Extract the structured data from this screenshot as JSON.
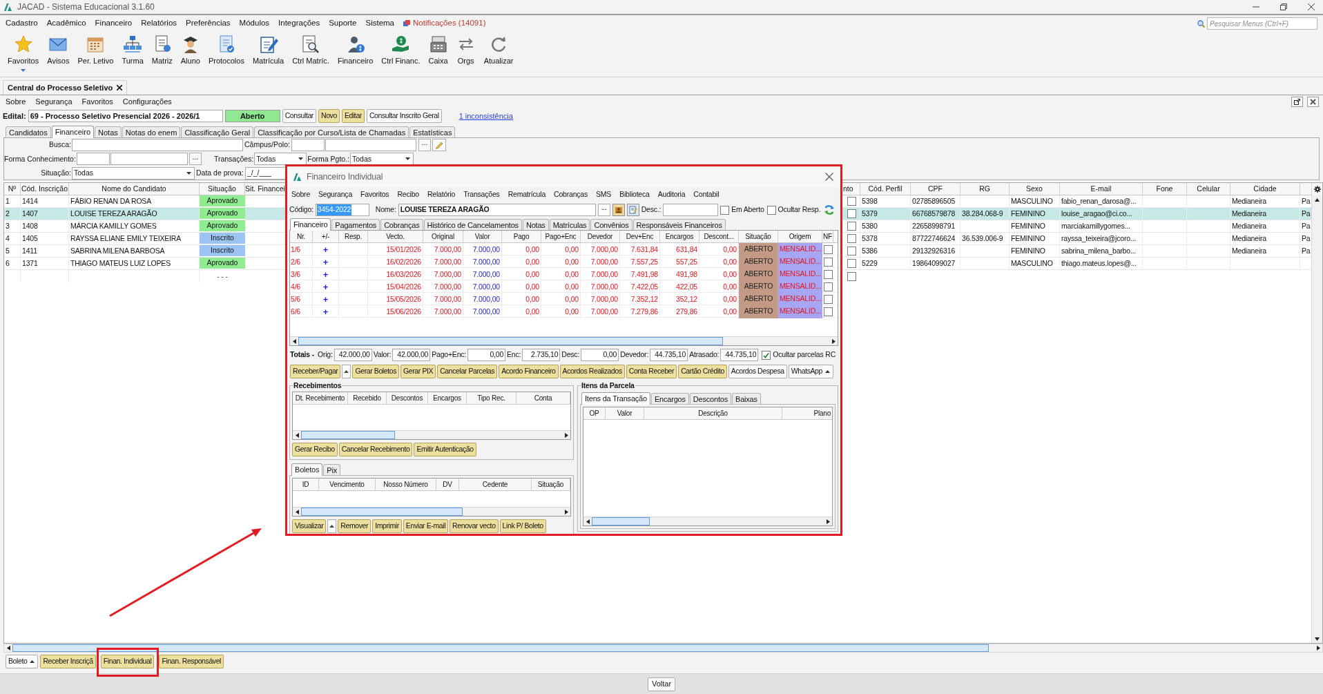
{
  "window": {
    "title": "JACAD - Sistema Educacional 3.1.60"
  },
  "menu": [
    "Cadastro",
    "Acadêmico",
    "Financeiro",
    "Relatórios",
    "Preferências",
    "Módulos",
    "Integrações",
    "Suporte",
    "Sistema"
  ],
  "notifications": "Notificações (14091)",
  "menu_search": {
    "placeholder": "Pesquisar Menus (Ctrl+F)"
  },
  "toolbar": [
    {
      "label": "Favoritos",
      "dropdown": true
    },
    {
      "label": "Avisos"
    },
    {
      "label": "Per. Letivo"
    },
    {
      "label": "Turma"
    },
    {
      "label": "Matriz"
    },
    {
      "label": "Aluno"
    },
    {
      "label": "Protocolos"
    },
    {
      "label": "Matrícula"
    },
    {
      "label": "Ctrl Matríc."
    },
    {
      "label": "Financeiro"
    },
    {
      "label": "Ctrl Financ."
    },
    {
      "label": "Caixa"
    },
    {
      "label": "Orgs"
    },
    {
      "label": "Atualizar"
    }
  ],
  "document_tab": {
    "title": "Central do Processo Seletivo"
  },
  "submenu": [
    "Sobre",
    "Segurança",
    "Favoritos",
    "Configurações"
  ],
  "edital": {
    "label": "Edital:",
    "value": "69 - Processo Seletivo Presencial 2026 - 2026/1",
    "status": "Aberto",
    "buttons": [
      {
        "label": "Consultar",
        "kind": "plain"
      },
      {
        "label": "Novo",
        "kind": "action"
      },
      {
        "label": "Editar",
        "kind": "action"
      },
      {
        "label": "Consultar Inscrito Geral",
        "kind": "plain"
      }
    ],
    "link": "1 inconsistência"
  },
  "tabs": [
    {
      "label": "Candidatos",
      "selected": false
    },
    {
      "label": "Financeiro",
      "selected": true
    },
    {
      "label": "Notas",
      "selected": false
    },
    {
      "label": "Notas do enem",
      "selected": false
    },
    {
      "label": "Classificação Geral",
      "selected": false
    },
    {
      "label": "Classificação por Curso/Lista de Chamadas",
      "selected": false
    },
    {
      "label": "Estatísticas",
      "selected": false
    }
  ],
  "filters": {
    "busca": {
      "label": "Busca:"
    },
    "campus": {
      "label": "Câmpus/Polo:",
      "button": "..."
    },
    "forma_conhecimento": {
      "label": "Forma Conhecimento:",
      "button": "..."
    },
    "transacoes": {
      "label": "Transações:",
      "value": "Todas"
    },
    "forma_pgto": {
      "label": "Forma Pgto.:",
      "value": "Todas"
    },
    "situacao": {
      "label": "Situação:",
      "value": "Todas"
    },
    "data_prova": {
      "label": "Data de prova:",
      "value": "_/_/___"
    }
  },
  "table": {
    "columns": [
      "Nº",
      "Cód. Inscrição",
      "Nome do Candidato",
      "Situação",
      "Sit. Financei",
      "nto",
      "Cód. Perfil",
      "CPF",
      "RG",
      "Sexo",
      "E-mail",
      "Fone",
      "Celular",
      "Cidade"
    ],
    "rows": [
      {
        "no": "1",
        "code": "1414",
        "name": "FÁBIO RENAN DA ROSA",
        "status": "Aprovado",
        "color": "#90ec90",
        "checked": false,
        "profile": "5398",
        "cpf": "02785896505",
        "sex": "MASCULINO",
        "email": "fabio_renan_darosa@...",
        "city": "Medianeira",
        "column_16": "Pa",
        "selected": false
      },
      {
        "no": "2",
        "code": "1407",
        "name": "LOUISE TEREZA ARAGÃO",
        "status": "Aprovado",
        "color": "#90ec90",
        "checked": false,
        "profile": "5379",
        "cpf": "66768579878",
        "rg": "38.284.068-9",
        "sex": "FEMININO",
        "email": "louise_aragao@ci.co...",
        "city": "Medianeira",
        "column_16": "Pa",
        "selected": true
      },
      {
        "no": "3",
        "code": "1408",
        "name": "MÁRCIA KAMILLY GOMES",
        "status": "Aprovado",
        "color": "#90ec90",
        "checked": false,
        "profile": "5380",
        "cpf": "22658998791",
        "sex": "FEMININO",
        "email": "marciakamillygomes...",
        "city": "Medianeira",
        "column_16": "Pa",
        "selected": false
      },
      {
        "no": "4",
        "code": "1405",
        "name": "RAYSSA ELIANE EMILY TEIXEIRA",
        "status": "Inscrito",
        "color": "#9cc4f2",
        "checked": false,
        "profile": "5378",
        "cpf": "87722746624",
        "rg": "36.539.006-9",
        "sex": "FEMININO",
        "email": "rayssa_teixeira@jcoro...",
        "city": "Medianeira",
        "column_16": "Pa",
        "selected": false
      },
      {
        "no": "5",
        "code": "1411",
        "name": "SABRINA MILENA BARBOSA",
        "status": "Inscrito",
        "color": "#9cc4f2",
        "checked": false,
        "profile": "5386",
        "cpf": "29132926316",
        "sex": "FEMININO",
        "email": "sabrina_milena_barbo...",
        "city": "Medianeira",
        "column_16": "Pa",
        "selected": false
      },
      {
        "no": "6",
        "code": "1371",
        "name": "THIAGO MATEUS LUIZ LOPES",
        "status": "Aprovado",
        "color": "#90ec90",
        "checked": false,
        "profile": "5229",
        "cpf": "19864099027",
        "sex": "MASCULINO",
        "email": "thiago.mateus.lopes@...",
        "selected": false
      }
    ],
    "new_row": {
      "status": "- - -",
      "checked": false
    }
  },
  "bottom_buttons": [
    {
      "label": "Boleto",
      "kind": "plain",
      "caret": true
    },
    {
      "label": "Receber Inscriçã",
      "kind": "action"
    },
    {
      "label": "Finan. Individual",
      "kind": "action"
    },
    {
      "label": "Finan. Responsável",
      "kind": "action"
    }
  ],
  "footer_button": "Voltar",
  "dialog": {
    "title": "Financeiro Individual",
    "menu": [
      "Sobre",
      "Segurança",
      "Favoritos",
      "Recibo",
      "Relatório",
      "Transações",
      "Rematrícula",
      "Cobranças",
      "SMS",
      "Biblioteca",
      "Auditoria",
      "Contabil"
    ],
    "codigo": {
      "label": "Código:",
      "value": "3454-2022"
    },
    "nome": {
      "label": "Nome:",
      "value": "LOUISE TEREZA ARAGÃO",
      "button": "..."
    },
    "desc": {
      "label": "Desc.:"
    },
    "options": [
      {
        "label": "Em Aberto",
        "checked": false
      },
      {
        "label": "Ocultar Resp.",
        "checked": false
      }
    ],
    "tabs": [
      {
        "label": "Financeiro",
        "selected": true
      },
      {
        "label": "Pagamentos",
        "selected": false
      },
      {
        "label": "Cobranças",
        "selected": false
      },
      {
        "label": "Histórico de Cancelamentos",
        "selected": false
      },
      {
        "label": "Notas",
        "selected": false
      },
      {
        "label": "Matrículas",
        "selected": false
      },
      {
        "label": "Convênios",
        "selected": false
      },
      {
        "label": "Responsáveis Financeiros",
        "selected": false
      }
    ],
    "installments": {
      "columns": [
        "Nr.",
        "+/-",
        "Resp.",
        "Vecto.",
        "Original",
        "Valor",
        "Pago",
        "Pago+Enc",
        "Devedor",
        "Dev+Enc",
        "Encargos",
        "Descont...",
        "Situação",
        "Origem",
        "NF"
      ],
      "rows": [
        {
          "nr": "1/6",
          "sign": "+",
          "vecto": "15/01/2026",
          "original": "7.000,00",
          "valor": "7.000,00",
          "pago": "0,00",
          "pago_enc": "0,00",
          "devedor": "7.000,00",
          "dev_enc": "7.631,84",
          "encargos": "631,84",
          "descontos": "0,00",
          "situacao": "ABERTO",
          "origem": "MENSALID...",
          "nf_checked": false
        },
        {
          "nr": "2/6",
          "sign": "+",
          "vecto": "16/02/2026",
          "original": "7.000,00",
          "valor": "7.000,00",
          "pago": "0,00",
          "pago_enc": "0,00",
          "devedor": "7.000,00",
          "dev_enc": "7.557,25",
          "encargos": "557,25",
          "descontos": "0,00",
          "situacao": "ABERTO",
          "origem": "MENSALID...",
          "nf_checked": false
        },
        {
          "nr": "3/6",
          "sign": "+",
          "vecto": "16/03/2026",
          "original": "7.000,00",
          "valor": "7.000,00",
          "pago": "0,00",
          "pago_enc": "0,00",
          "devedor": "7.000,00",
          "dev_enc": "7.491,98",
          "encargos": "491,98",
          "descontos": "0,00",
          "situacao": "ABERTO",
          "origem": "MENSALID...",
          "nf_checked": false
        },
        {
          "nr": "4/6",
          "sign": "+",
          "vecto": "15/04/2026",
          "original": "7.000,00",
          "valor": "7.000,00",
          "pago": "0,00",
          "pago_enc": "0,00",
          "devedor": "7.000,00",
          "dev_enc": "7.422,05",
          "encargos": "422,05",
          "descontos": "0,00",
          "situacao": "ABERTO",
          "origem": "MENSALID...",
          "nf_checked": false
        },
        {
          "nr": "5/6",
          "sign": "+",
          "vecto": "15/05/2026",
          "original": "7.000,00",
          "valor": "7.000,00",
          "pago": "0,00",
          "pago_enc": "0,00",
          "devedor": "7.000,00",
          "dev_enc": "7.352,12",
          "encargos": "352,12",
          "descontos": "0,00",
          "situacao": "ABERTO",
          "origem": "MENSALID...",
          "nf_checked": false
        },
        {
          "nr": "6/6",
          "sign": "+",
          "vecto": "15/06/2026",
          "original": "7.000,00",
          "valor": "7.000,00",
          "pago": "0,00",
          "pago_enc": "0,00",
          "devedor": "7.000,00",
          "dev_enc": "7.279,86",
          "encargos": "279,86",
          "descontos": "0,00",
          "situacao": "ABERTO",
          "origem": "MENSALID...",
          "nf_checked": false
        }
      ]
    },
    "totals": {
      "label": "Totais -",
      "fields": [
        {
          "label": "Orig:",
          "value": "42.000,00"
        },
        {
          "label": "Valor:",
          "value": "42.000,00"
        },
        {
          "label": "Pago+Enc:",
          "value": "0,00"
        },
        {
          "label": "Enc:",
          "value": "2.735,10"
        },
        {
          "label": "Desc:",
          "value": "0,00"
        },
        {
          "label": "Devedor:",
          "value": "44.735,10"
        },
        {
          "label": "Atrasado:",
          "value": "44.735,10"
        }
      ],
      "hide_rc": {
        "label": "Ocultar parcelas RC",
        "checked": true
      }
    },
    "buttons": [
      {
        "label": "Receber/Pagar",
        "kind": "action",
        "split": true
      },
      {
        "label": "Gerar Boletos",
        "kind": "action"
      },
      {
        "label": "Gerar PIX",
        "kind": "action"
      },
      {
        "label": "Cancelar Parcelas",
        "kind": "action"
      },
      {
        "label": "Acordo Financeiro",
        "kind": "action"
      },
      {
        "label": "Acordos Realizados",
        "kind": "action"
      },
      {
        "label": "Conta Receber",
        "kind": "action"
      },
      {
        "label": "Cartão Crédito",
        "kind": "action"
      },
      {
        "label": "Acordos Despesa",
        "kind": "plain"
      },
      {
        "label": "WhatsApp",
        "kind": "plain",
        "caret": true
      }
    ],
    "receipts": {
      "title": "Recebimentos",
      "columns": [
        "Dt. Recebimento",
        "Recebido",
        "Descontos",
        "Encargos",
        "Tipo Rec.",
        "Conta"
      ],
      "buttons": [
        {
          "label": "Gerar Recibo",
          "kind": "action"
        },
        {
          "label": "Cancelar Recebimento",
          "kind": "action"
        },
        {
          "label": "Emitir Autenticação",
          "kind": "action"
        }
      ]
    },
    "slips": {
      "tabs": [
        {
          "label": "Boletos",
          "selected": true
        },
        {
          "label": "Pix",
          "selected": false
        }
      ],
      "columns": [
        "ID",
        "Vencimento",
        "Nosso Número",
        "DV",
        "Cedente",
        "Situação"
      ],
      "buttons": [
        {
          "label": "Visualizar",
          "kind": "action",
          "split": true
        },
        {
          "label": "Remover",
          "kind": "action"
        },
        {
          "label": "Imprimir",
          "kind": "action"
        },
        {
          "label": "Enviar E-mail",
          "kind": "action"
        },
        {
          "label": "Renovar vecto",
          "kind": "action"
        },
        {
          "label": "Link P/ Boleto",
          "kind": "action"
        }
      ]
    },
    "items": {
      "title": "Itens da Parcela",
      "tabs": [
        {
          "label": "Itens da Transação",
          "selected": true
        },
        {
          "label": "Encargos",
          "selected": false
        },
        {
          "label": "Descontos",
          "selected": false
        },
        {
          "label": "Baixas",
          "selected": false
        }
      ],
      "columns": [
        "OP",
        "Valor",
        "Descrição",
        "Plano"
      ]
    }
  }
}
